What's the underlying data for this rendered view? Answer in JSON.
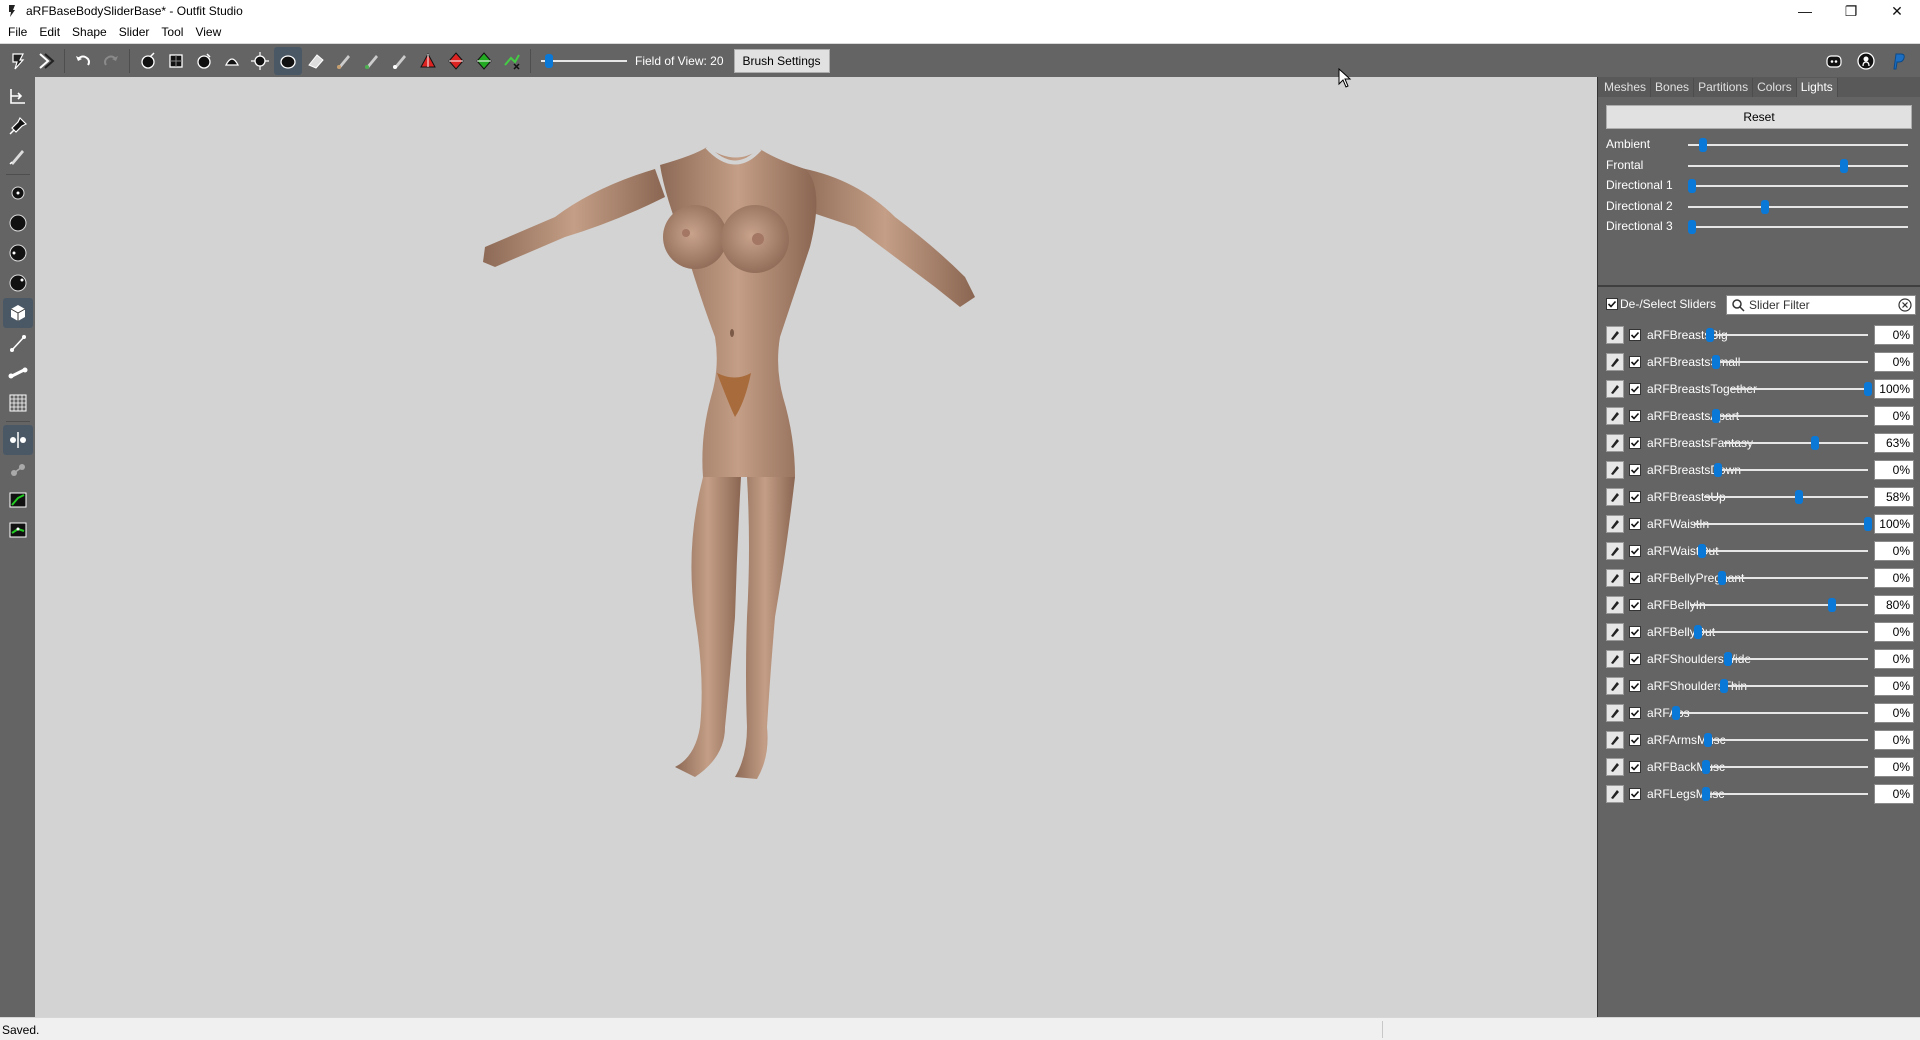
{
  "window": {
    "title": "aRFBaseBodySliderBase* - Outfit Studio",
    "controls": [
      "minimize-icon",
      "restore-icon",
      "close-icon"
    ]
  },
  "menu": [
    "File",
    "Edit",
    "Shape",
    "Slider",
    "Tool",
    "View"
  ],
  "toolbar": {
    "fov_label": "Field of View: 20",
    "fov_level": 0.05,
    "brush_settings_label": "Brush Settings",
    "icons_left": [
      "select-icon",
      "transform-icon",
      "undo-icon",
      "redo-icon",
      "brush-icon",
      "mask-icon",
      "inflate-icon",
      "deflate-icon",
      "move-icon",
      "smooth-icon",
      "erase-icon",
      "paint-icon",
      "paint-color-icon",
      "weight-icon",
      "triangle-icon",
      "diamond-icon",
      "collapse-icon",
      "alpha-icon"
    ],
    "icons_right": [
      "discord-icon",
      "github-icon",
      "paypal-icon"
    ]
  },
  "left_tools": [
    "transform-icon",
    "pin-icon",
    "pencil-icon",
    "vertex-small-icon",
    "vertex-medium-icon",
    "vertex-large-icon",
    "vertex-xlarge-icon",
    "cube-icon",
    "edge-icon",
    "bone-icon",
    "grid-icon",
    "xmirror-icon",
    "connect-icon",
    "weight-green-icon",
    "weight-green2-icon"
  ],
  "panel": {
    "tabs": [
      "Meshes",
      "Bones",
      "Partitions",
      "Colors",
      "Lights"
    ],
    "active_tab": "Lights",
    "reset_label": "Reset",
    "lights": [
      {
        "label": "Ambient",
        "level": 0.07
      },
      {
        "label": "Frontal",
        "level": 0.71
      },
      {
        "label": "Directional 1",
        "level": 0.02
      },
      {
        "label": "Directional 2",
        "level": 0.35
      },
      {
        "label": "Directional 3",
        "level": 0.02
      }
    ],
    "deselect_label": "De-/Select Sliders",
    "filter_placeholder": "Slider Filter",
    "sliders": [
      {
        "name": "aRFBreastsBig",
        "value": "0%",
        "level": 0.0
      },
      {
        "name": "aRFBreastsSmall",
        "value": "0%",
        "level": 0.0
      },
      {
        "name": "aRFBreastsTogether",
        "value": "100%",
        "level": 1.0
      },
      {
        "name": "aRFBreastsApart",
        "value": "0%",
        "level": 0.0
      },
      {
        "name": "aRFBreastsFantasy",
        "value": "63%",
        "level": 0.63
      },
      {
        "name": "aRFBreastsDown",
        "value": "0%",
        "level": 0.0
      },
      {
        "name": "aRFBreastsUp",
        "value": "58%",
        "level": 0.58
      },
      {
        "name": "aRFWaistIn",
        "value": "100%",
        "level": 1.0
      },
      {
        "name": "aRFWaistOut",
        "value": "0%",
        "level": 0.0
      },
      {
        "name": "aRFBellyPregnant",
        "value": "0%",
        "level": 0.0
      },
      {
        "name": "aRFBellyIn",
        "value": "80%",
        "level": 0.8
      },
      {
        "name": "aRFBellyOut",
        "value": "0%",
        "level": 0.0
      },
      {
        "name": "aRFShouldersWide",
        "value": "0%",
        "level": 0.0
      },
      {
        "name": "aRFShouldersThin",
        "value": "0%",
        "level": 0.0
      },
      {
        "name": "aRFAbs",
        "value": "0%",
        "level": 0.0
      },
      {
        "name": "aRFArmsMusc",
        "value": "0%",
        "level": 0.0
      },
      {
        "name": "aRFBackMusc",
        "value": "0%",
        "level": 0.0
      },
      {
        "name": "aRFLegsMusc",
        "value": "0%",
        "level": 0.0
      }
    ]
  },
  "status": {
    "text": "Saved."
  },
  "colors": {
    "toolbar": "#646464",
    "viewport": "#d3d3d3",
    "accent": "#0a78d7",
    "skin": "#c09a80"
  }
}
